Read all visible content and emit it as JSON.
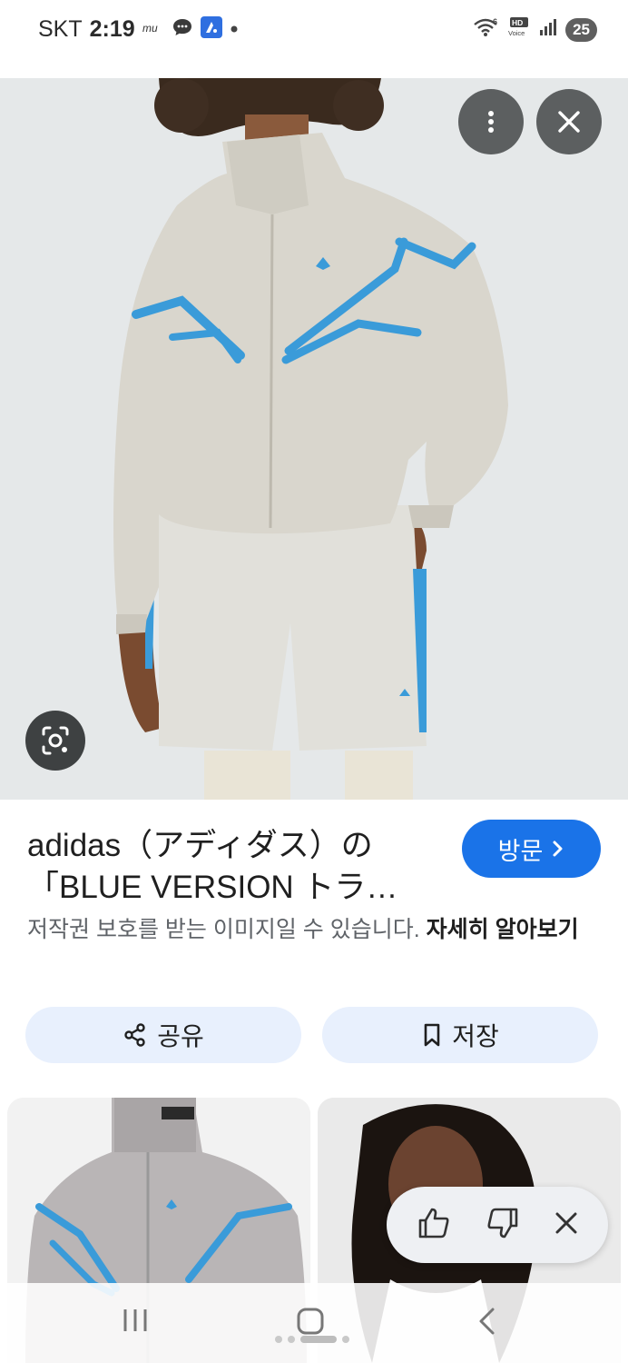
{
  "status_bar": {
    "carrier": "SKT",
    "time": "2:19",
    "battery": "25",
    "network_label": "HD Voice",
    "wifi_label": "6"
  },
  "result": {
    "title": "adidas（アディダス）の\n「BLUE VERSION トラ…",
    "visit_label": "방문",
    "copyright_text": "저작권 보호를 받는 이미지일 수 있습니다. ",
    "learn_more": "자세히 알아보기"
  },
  "actions": {
    "share_label": "공유",
    "save_label": "저장"
  },
  "colors": {
    "accent_blue": "#1a73e8",
    "pill_bg": "#e8f0fd",
    "jacket_trim": "#3a9bd9"
  },
  "icons": {
    "more": "more-vert-icon",
    "close": "close-icon",
    "lens": "google-lens-icon",
    "share": "share-icon",
    "save": "bookmark-icon",
    "thumbs_up": "thumbs-up-icon",
    "thumbs_down": "thumbs-down-icon"
  }
}
